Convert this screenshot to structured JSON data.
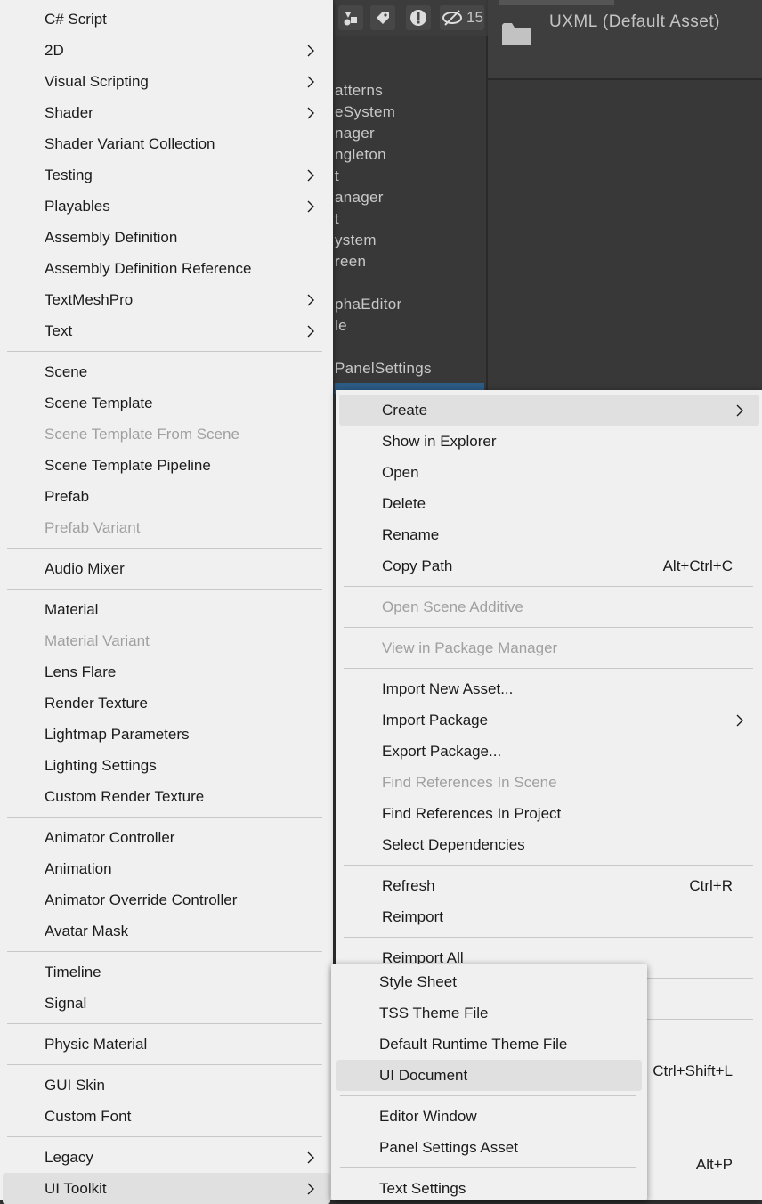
{
  "background": {
    "toolbar_count": "15",
    "preview_label": "UXML (Default Asset)",
    "tree_rows": [
      "atterns",
      "eSystem",
      "nager",
      "ngleton",
      "t",
      "anager",
      "t",
      "ystem",
      "reen",
      "",
      "phaEditor",
      "le",
      "",
      "PanelSettings"
    ]
  },
  "left_menu": {
    "items": [
      {
        "label": "C# Script",
        "sub": false,
        "disabled": false
      },
      {
        "label": "2D",
        "sub": true,
        "disabled": false
      },
      {
        "label": "Visual Scripting",
        "sub": true,
        "disabled": false
      },
      {
        "label": "Shader",
        "sub": true,
        "disabled": false
      },
      {
        "label": "Shader Variant Collection",
        "sub": false,
        "disabled": false
      },
      {
        "label": "Testing",
        "sub": true,
        "disabled": false
      },
      {
        "label": "Playables",
        "sub": true,
        "disabled": false
      },
      {
        "label": "Assembly Definition",
        "sub": false,
        "disabled": false
      },
      {
        "label": "Assembly Definition Reference",
        "sub": false,
        "disabled": false
      },
      {
        "label": "TextMeshPro",
        "sub": true,
        "disabled": false
      },
      {
        "label": "Text",
        "sub": true,
        "disabled": false
      },
      {
        "sep": true
      },
      {
        "label": "Scene",
        "sub": false,
        "disabled": false
      },
      {
        "label": "Scene Template",
        "sub": false,
        "disabled": false
      },
      {
        "label": "Scene Template From Scene",
        "sub": false,
        "disabled": true
      },
      {
        "label": "Scene Template Pipeline",
        "sub": false,
        "disabled": false
      },
      {
        "label": "Prefab",
        "sub": false,
        "disabled": false
      },
      {
        "label": "Prefab Variant",
        "sub": false,
        "disabled": true
      },
      {
        "sep": true
      },
      {
        "label": "Audio Mixer",
        "sub": false,
        "disabled": false
      },
      {
        "sep": true
      },
      {
        "label": "Material",
        "sub": false,
        "disabled": false
      },
      {
        "label": "Material Variant",
        "sub": false,
        "disabled": true
      },
      {
        "label": "Lens Flare",
        "sub": false,
        "disabled": false
      },
      {
        "label": "Render Texture",
        "sub": false,
        "disabled": false
      },
      {
        "label": "Lightmap Parameters",
        "sub": false,
        "disabled": false
      },
      {
        "label": "Lighting Settings",
        "sub": false,
        "disabled": false
      },
      {
        "label": "Custom Render Texture",
        "sub": false,
        "disabled": false
      },
      {
        "sep": true
      },
      {
        "label": "Animator Controller",
        "sub": false,
        "disabled": false
      },
      {
        "label": "Animation",
        "sub": false,
        "disabled": false
      },
      {
        "label": "Animator Override Controller",
        "sub": false,
        "disabled": false
      },
      {
        "label": "Avatar Mask",
        "sub": false,
        "disabled": false
      },
      {
        "sep": true
      },
      {
        "label": "Timeline",
        "sub": false,
        "disabled": false
      },
      {
        "label": "Signal",
        "sub": false,
        "disabled": false
      },
      {
        "sep": true
      },
      {
        "label": "Physic Material",
        "sub": false,
        "disabled": false
      },
      {
        "sep": true
      },
      {
        "label": "GUI Skin",
        "sub": false,
        "disabled": false
      },
      {
        "label": "Custom Font",
        "sub": false,
        "disabled": false
      },
      {
        "sep": true
      },
      {
        "label": "Legacy",
        "sub": true,
        "disabled": false
      },
      {
        "label": "UI Toolkit",
        "sub": true,
        "disabled": false,
        "highlighted": true
      }
    ]
  },
  "context_menu": {
    "items": [
      {
        "label": "Create",
        "sub": true,
        "highlighted": true
      },
      {
        "label": "Show in Explorer"
      },
      {
        "label": "Open"
      },
      {
        "label": "Delete"
      },
      {
        "label": "Rename"
      },
      {
        "label": "Copy Path",
        "shortcut": "Alt+Ctrl+C"
      },
      {
        "sep": true
      },
      {
        "label": "Open Scene Additive",
        "disabled": true
      },
      {
        "sep": true
      },
      {
        "label": "View in Package Manager",
        "disabled": true
      },
      {
        "sep": true
      },
      {
        "label": "Import New Asset..."
      },
      {
        "label": "Import Package",
        "sub": true
      },
      {
        "label": "Export Package..."
      },
      {
        "label": "Find References In Scene",
        "disabled": true
      },
      {
        "label": "Find References In Project"
      },
      {
        "label": "Select Dependencies"
      },
      {
        "sep": true
      },
      {
        "label": "Refresh",
        "shortcut": "Ctrl+R"
      },
      {
        "label": "Reimport"
      },
      {
        "sep": true
      },
      {
        "label": "Reimport All"
      },
      {
        "sep": true
      },
      {
        "label": ""
      },
      {
        "sep": true
      },
      {
        "label": ""
      },
      {
        "label": "",
        "shortcut": "Ctrl+Shift+L"
      },
      {
        "label": ""
      },
      {
        "label": ""
      },
      {
        "label": "",
        "shortcut": "Alt+P"
      }
    ]
  },
  "ui_toolkit_menu": {
    "items": [
      {
        "label": "Style Sheet"
      },
      {
        "label": "TSS Theme File"
      },
      {
        "label": "Default Runtime Theme File"
      },
      {
        "label": "UI Document",
        "highlighted": true
      },
      {
        "sep": true
      },
      {
        "label": "Editor Window"
      },
      {
        "label": "Panel Settings Asset"
      },
      {
        "sep": true
      },
      {
        "label": "Text Settings"
      }
    ]
  },
  "colors": {
    "menu_bg": "#f0f0f0",
    "highlight": "#e0e0e0",
    "disabled_text": "#a0a0a0",
    "selection_blue": "#2c5d87"
  }
}
